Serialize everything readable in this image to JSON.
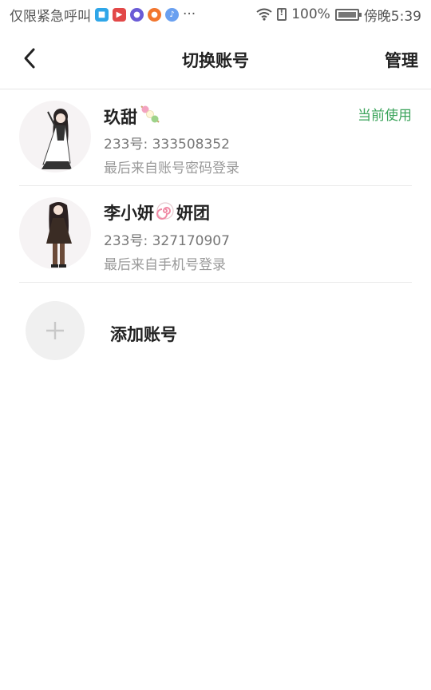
{
  "status_bar": {
    "left_text": "仅限紧急呼叫",
    "more": "···",
    "battery": "100%",
    "time": "傍晚5:39"
  },
  "header": {
    "title": "切换账号",
    "manage_label": "管理"
  },
  "accounts": [
    {
      "name": "玖甜",
      "name_emoji": "🍡",
      "id_text": "233号: 333508352",
      "login_text": "最后来自账号密码登录",
      "current_label": "当前使用"
    },
    {
      "name_prefix": "李小妍",
      "name_emoji": "🍥",
      "name_suffix": "妍团",
      "id_text": "233号: 327170907",
      "login_text": "最后来自手机号登录"
    }
  ],
  "add_account": {
    "label": "添加账号"
  },
  "colors": {
    "current": "#3aa35a",
    "divider": "#eaeaea"
  }
}
